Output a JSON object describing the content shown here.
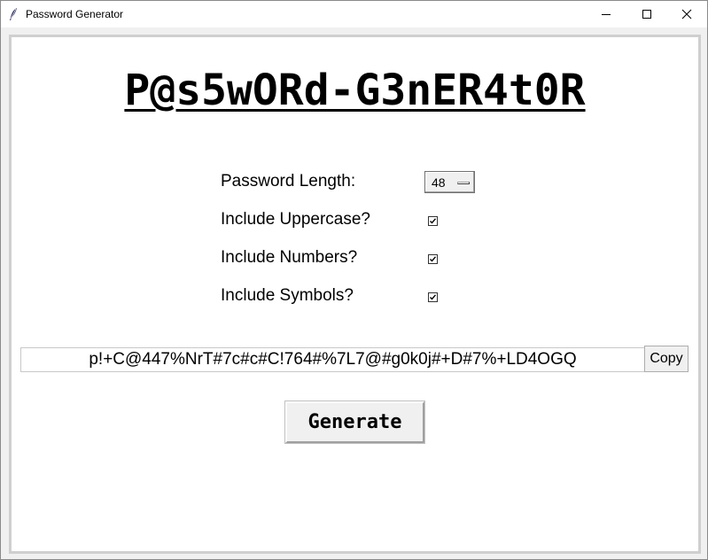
{
  "window": {
    "title": "Password Generator",
    "controls": {
      "minimize": "minimize-icon",
      "maximize": "maximize-icon",
      "close": "close-icon"
    }
  },
  "app": {
    "heading": "P@s5wORd-G3nER4t0R",
    "options": {
      "length_label": "Password Length:",
      "length_value": "48",
      "uppercase_label": "Include Uppercase?",
      "uppercase_checked": true,
      "numbers_label": "Include Numbers?",
      "numbers_checked": true,
      "symbols_label": "Include Symbols?",
      "symbols_checked": true
    },
    "password": "p!+C@447%NrT#7c#c#C!764#%7L7@#g0k0j#+D#7%+LD4OGQ",
    "copy_label": "Copy",
    "generate_label": "Generate"
  },
  "colors": {
    "background": "#ffffff",
    "frame": "#cfcfcf",
    "text": "#000000"
  }
}
